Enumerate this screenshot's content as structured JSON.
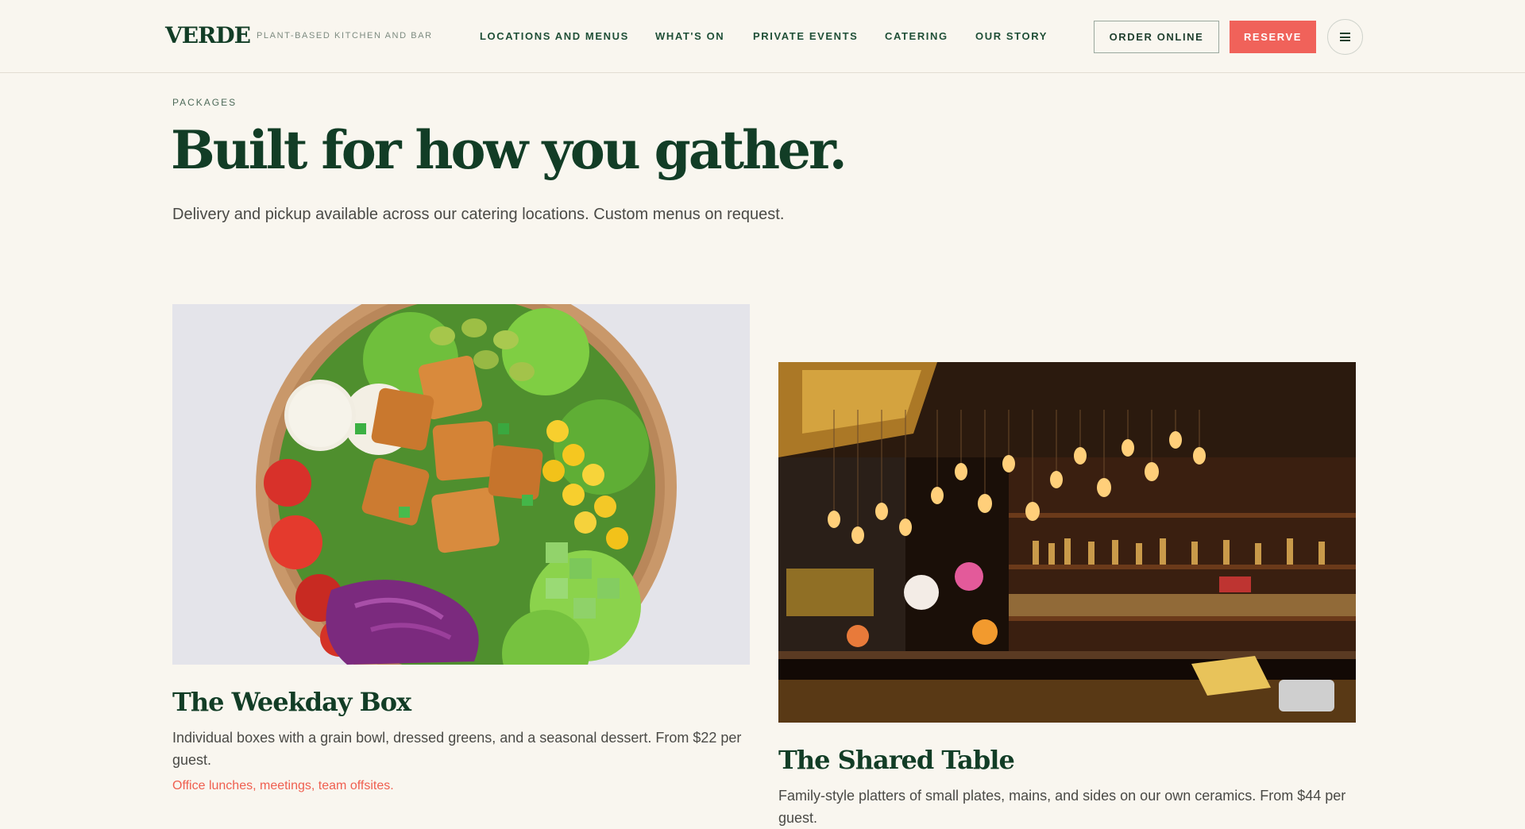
{
  "header": {
    "logo": "VERDE",
    "tagline": "PLANT-BASED KITCHEN AND BAR",
    "nav": [
      {
        "label": "LOCATIONS AND MENUS"
      },
      {
        "label": "WHAT'S ON"
      },
      {
        "label": "PRIVATE EVENTS"
      },
      {
        "label": "CATERING"
      },
      {
        "label": "OUR STORY"
      }
    ],
    "order_label": "ORDER ONLINE",
    "reserve_label": "RESERVE",
    "menu_icon": "hamburger-menu-icon"
  },
  "hero": {
    "eyebrow": "PACKAGES",
    "headline": "Built for how you gather.",
    "subhead": "Delivery and pickup available across our catering locations. Custom menus on request."
  },
  "cards": [
    {
      "image": "grain-bowl-photo",
      "title": "The Weekday Box",
      "description": "Individual boxes with a grain bowl, dressed greens, and a seasonal dessert. From $22 per guest.",
      "tags": "Office lunches, meetings, team offsites."
    },
    {
      "image": "bar-interior-photo",
      "title": "The Shared Table",
      "description": "Family-style platters of small plates, mains, and sides on our own ceramics. From $44 per guest."
    }
  ],
  "colors": {
    "background": "#f9f6ef",
    "brand_green": "#123d26",
    "accent_coral": "#f0625a",
    "tag_coral": "#ef5f4f"
  }
}
